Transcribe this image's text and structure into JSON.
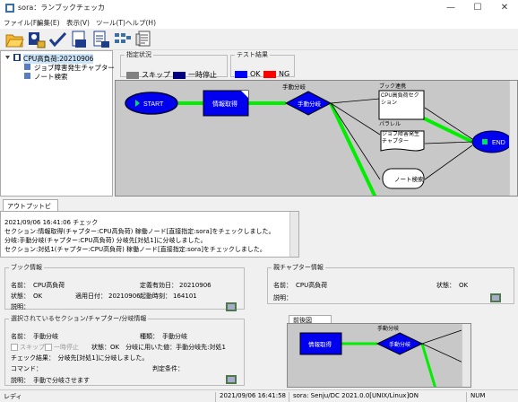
{
  "window": {
    "title": "sora：ランブックチェッカ",
    "min_glyph": "—",
    "max_glyph": "☐",
    "close_glyph": "✕"
  },
  "menu": [
    "ファイル(F)",
    "編集(E)",
    "表示(V)",
    "ツール(T)",
    "ヘルプ(H)"
  ],
  "tree": {
    "root": "CPU高負荷:20210906",
    "children": [
      "ジョブ障害発生チャプター",
      "ノート検索"
    ]
  },
  "legend": {
    "spec_title": "指定状況",
    "skip": "スキップ",
    "pause": "一時停止",
    "test_title": "テスト結果",
    "ok": "OK",
    "ng": "NG",
    "colors": {
      "skip": "#808080",
      "pause": "#00007f",
      "ok": "#0000ff",
      "ng": "#ff0000"
    }
  },
  "flow": {
    "start": "START",
    "info": "情報取得",
    "branch_caption": "手動分岐",
    "branch": "手動分岐",
    "book_caption": "ブック連携",
    "book_text": "CPU高負荷セクション",
    "parallel_caption": "パラレル",
    "job_text": "ジョブ障害発生チャプター",
    "note": "ノート検索",
    "end": "END"
  },
  "output": {
    "tab": "アウトプットビュー",
    "lines": [
      "2021/09/06 16:41:06 チェック",
      "セクション:情報取得(チャプター:CPU高負荷) 稼働ノード[直接指定:sora]をチェックしました。",
      "分岐:手動分岐(チャプター:CPU高負荷) 分岐先[対処1]に分岐しました。",
      "セクション:対処1(チャプター:CPU高負荷) 稼働ノード[直接指定:sora]をチェックしました。"
    ]
  },
  "book_info": {
    "title": "ブック情報",
    "name_label": "名前：",
    "name": "CPU高負荷",
    "status_label": "状態：",
    "status": "OK",
    "apply_label": "適用日付：",
    "apply": "20210906",
    "def_label": "定義有効日：",
    "def": "20210906",
    "start_label": "起動時刻：",
    "start": "164101",
    "desc_label": "説明："
  },
  "parent_info": {
    "title": "親チャプター情報",
    "name_label": "名前：",
    "name": "CPU高負荷",
    "status_label": "状態：",
    "status": "OK",
    "desc_label": "説明："
  },
  "sel_info": {
    "title": "選択されているセクション/チャプター/分岐情報",
    "name_label": "名前：",
    "name": "手動分岐",
    "kind_label": "種類：",
    "kind": "手動分岐",
    "skip": "スキップ",
    "pause": "一時停止",
    "status_text": "状態：OK　分岐に用いた値：手動分岐先:対処1",
    "check_result": "チェック結果：　分岐先[対処1]に分岐しました。",
    "command_label": "コマンド：",
    "judge_label": "判定条件：",
    "desc_label": "説明：",
    "desc": "手動で分岐させます"
  },
  "minimap": {
    "tab": "前後図",
    "caption": "手動分岐",
    "info": "情報取得",
    "branch": "手動分岐"
  },
  "status": {
    "ready": "レディ",
    "time": "2021/09/06 16:41:58",
    "host": "sora: Senju/DC 2021.0.0[UNIX/Linux]ON",
    "num": "NUM"
  }
}
